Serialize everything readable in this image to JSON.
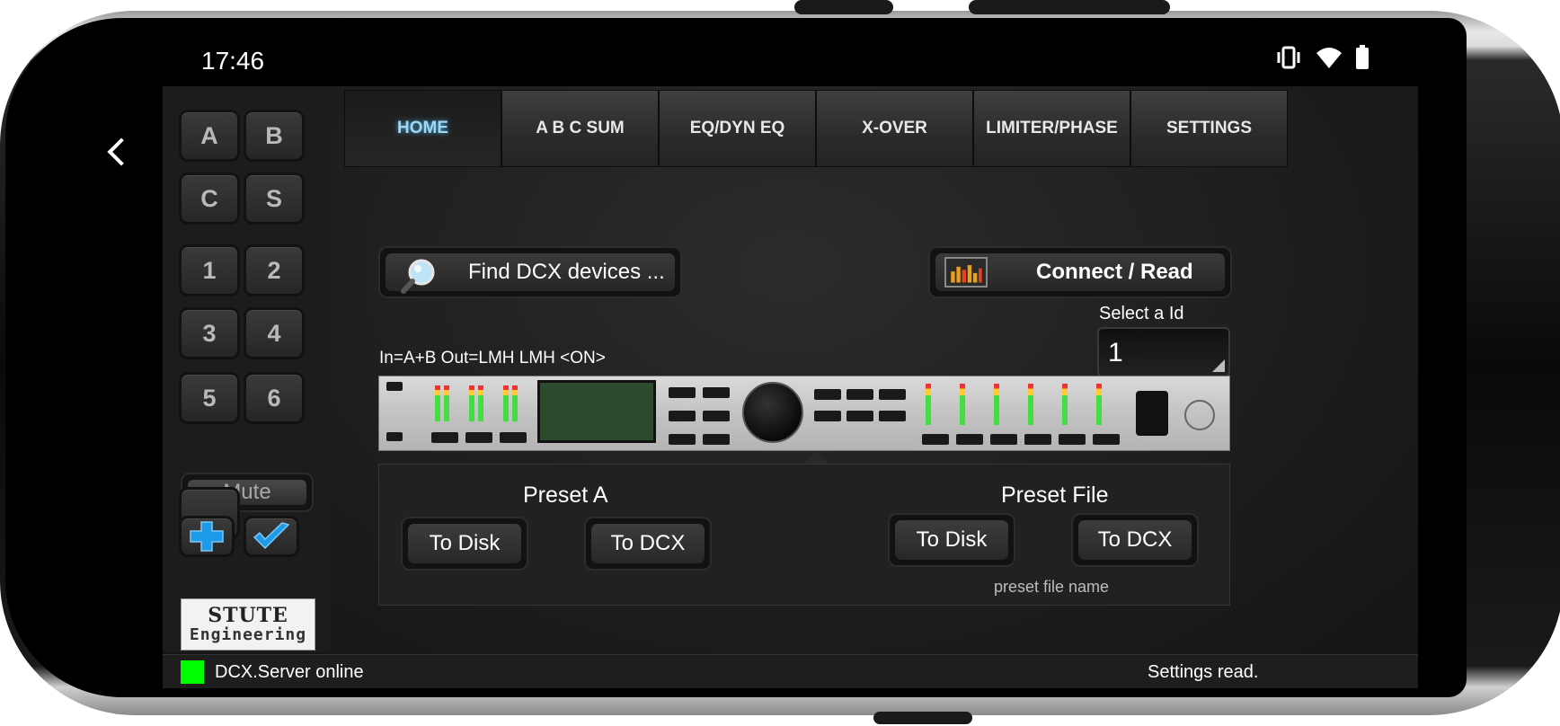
{
  "status_bar": {
    "time": "17:46"
  },
  "sidebar": {
    "channel_buttons": [
      "A",
      "B",
      "C",
      "S",
      "1",
      "2",
      "3",
      "4",
      "5",
      "6"
    ],
    "mute_label": "Mute",
    "logo": {
      "line1": "STUTE",
      "line2": "Engineering"
    }
  },
  "tabs": [
    {
      "label": "HOME",
      "active": true
    },
    {
      "label": "A B C SUM",
      "active": false
    },
    {
      "label": "EQ/DYN EQ",
      "active": false
    },
    {
      "label": "X-OVER",
      "active": false
    },
    {
      "label": "LIMITER/PHASE",
      "active": false
    },
    {
      "label": "SETTINGS",
      "active": false
    }
  ],
  "home": {
    "find_button": "Find DCX devices ...",
    "connect_button": "Connect / Read",
    "select_id_label": "Select a Id",
    "id_value": "1",
    "routing_text": "In=A+B  Out=LMH LMH <ON>"
  },
  "presets": {
    "preset_a": {
      "title": "Preset A",
      "to_disk": "To Disk",
      "to_dcx": "To DCX"
    },
    "preset_file": {
      "title": "Preset File",
      "to_disk": "To Disk",
      "to_dcx": "To DCX",
      "file_name_label": "preset file name"
    }
  },
  "footer": {
    "server_status": "DCX.Server online",
    "right_status": "Settings read.",
    "led_color": "#00ff00"
  },
  "colors": {
    "active_tab_text": "#9fd8f5",
    "accent_blue": "#1e9be8"
  }
}
